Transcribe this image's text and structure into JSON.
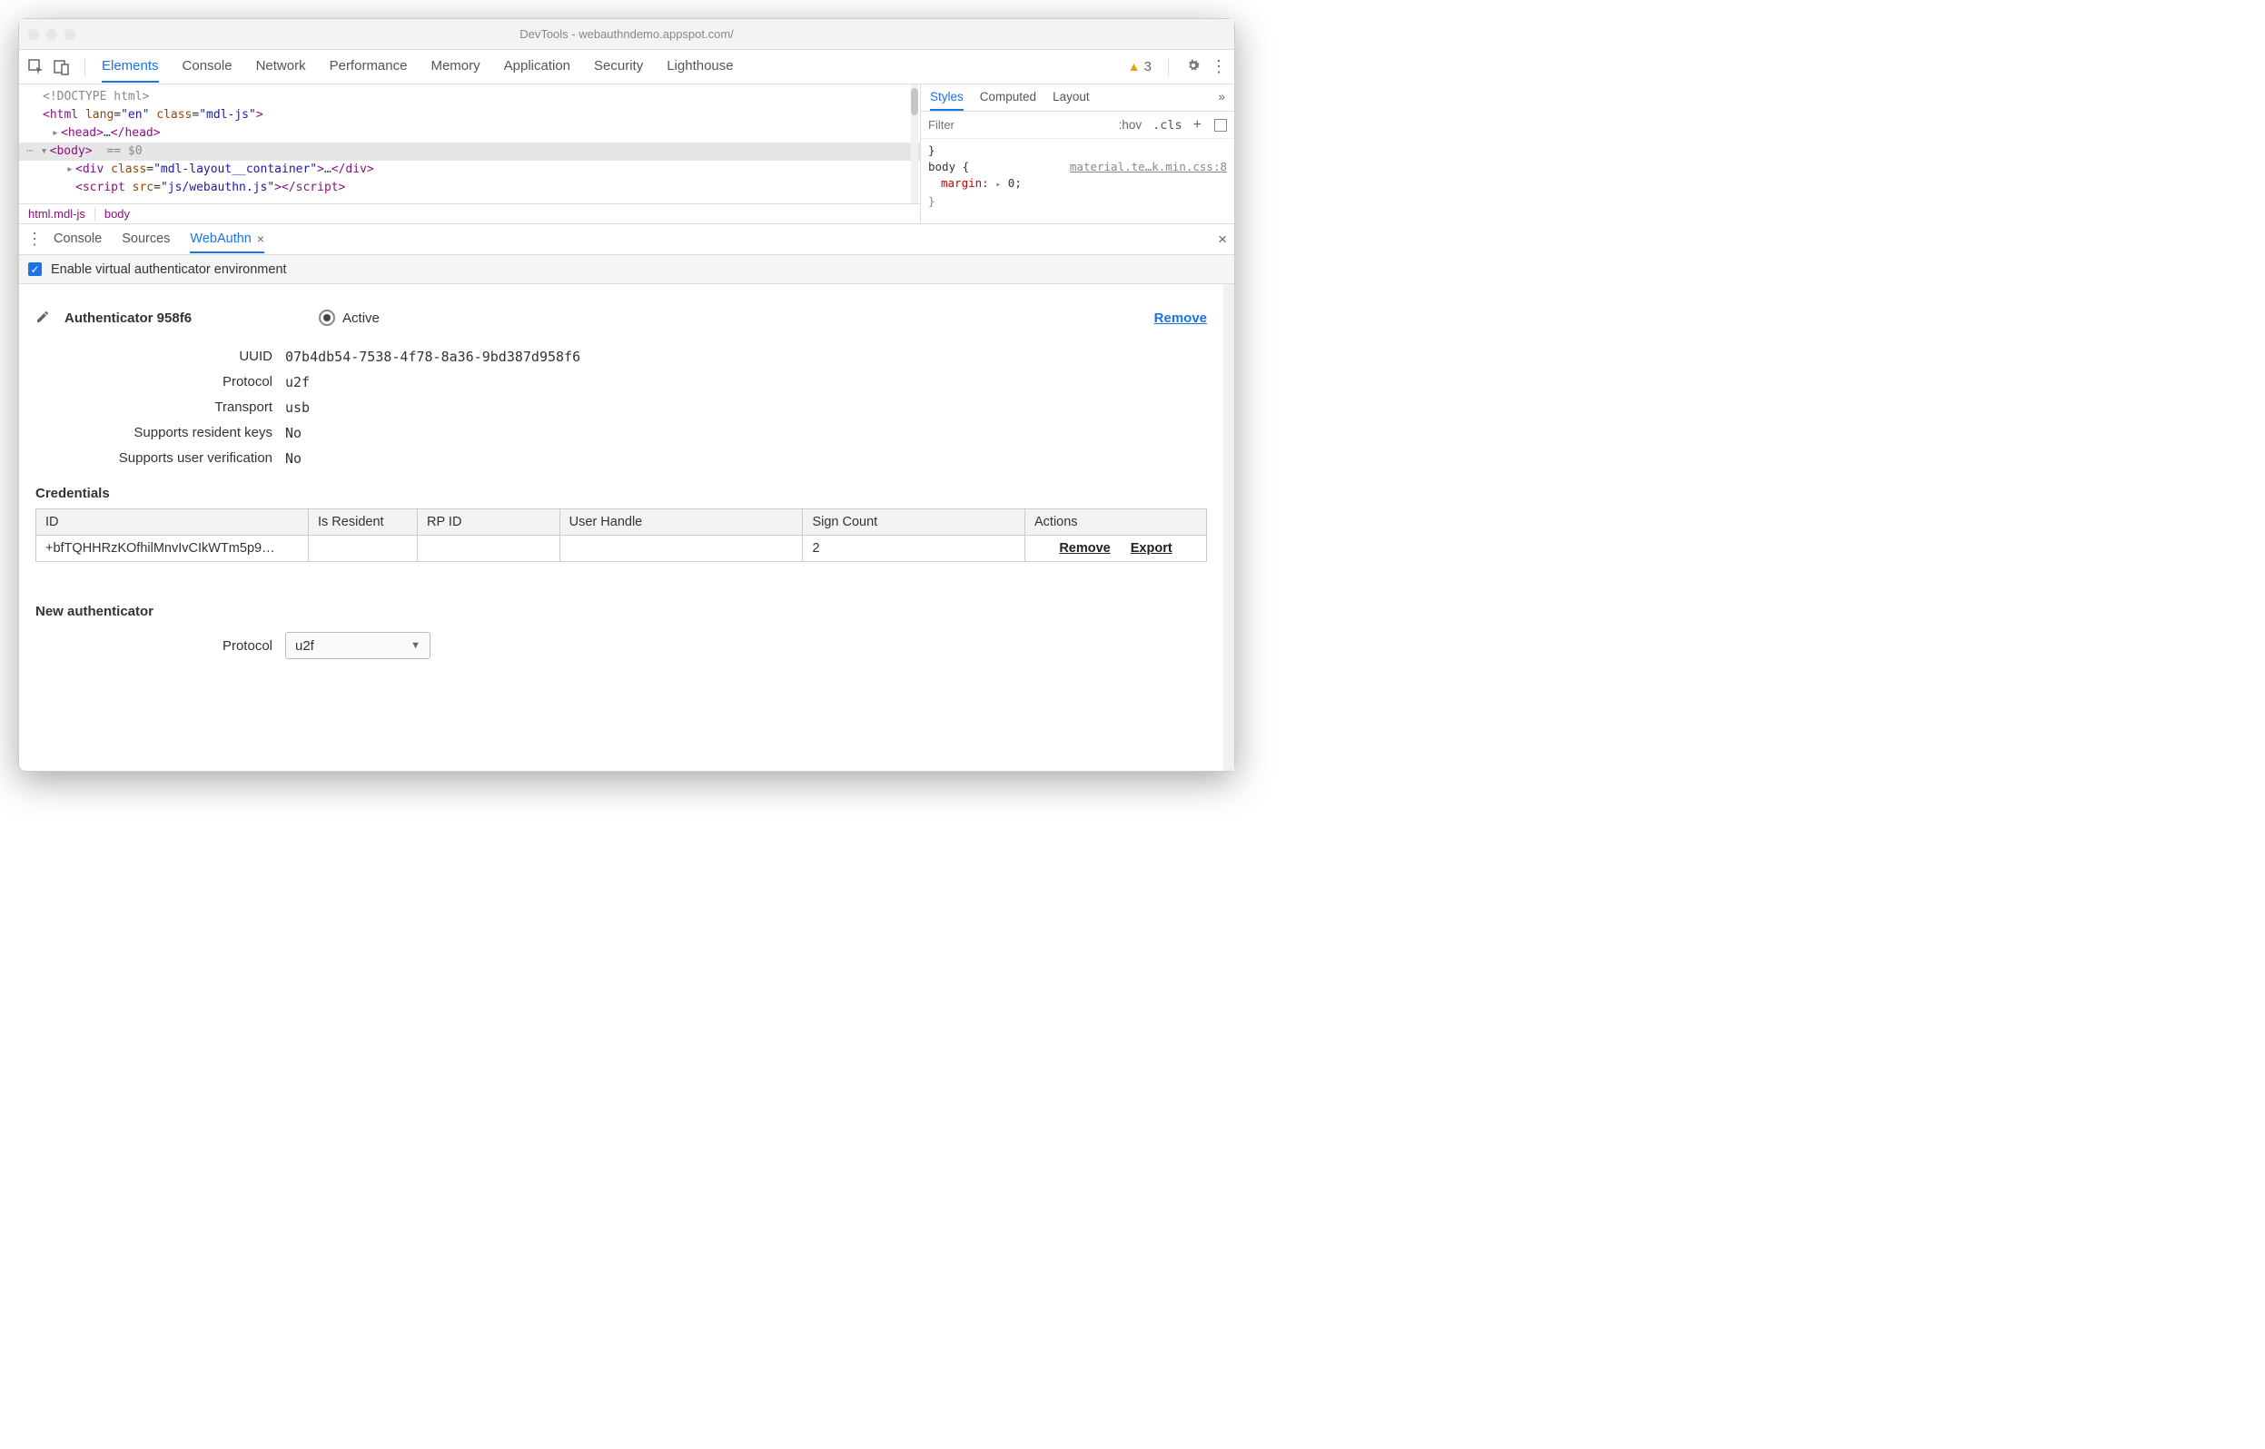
{
  "title": "DevTools - webauthndemo.appspot.com/",
  "toolbar": {
    "tabs": [
      "Elements",
      "Console",
      "Network",
      "Performance",
      "Memory",
      "Application",
      "Security",
      "Lighthouse"
    ],
    "active": 0,
    "warnings": "3"
  },
  "dom": {
    "doctype": "<!DOCTYPE html>",
    "html_open": "<html lang=\"en\" class=\"mdl-js\">",
    "head": "<head>…</head>",
    "body_sel": "<body> == $0",
    "div": "<div class=\"mdl-layout__container\">…</div>",
    "script": "<script src=\"js/webauthn.js\"></script>",
    "breadcrumb": [
      "html.mdl-js",
      "body"
    ]
  },
  "styles": {
    "tabs": [
      "Styles",
      "Computed",
      "Layout"
    ],
    "filter_ph": "Filter",
    "hov": ":hov",
    "cls": ".cls",
    "brace1": "}",
    "selector": "body {",
    "link": "material.te…k.min.css:8",
    "prop": "margin",
    "val": "0",
    "brace2": "}"
  },
  "drawer": {
    "tabs": [
      "Console",
      "Sources",
      "WebAuthn"
    ],
    "active": 2,
    "checkbox": "Enable virtual authenticator environment"
  },
  "authn": {
    "title": "Authenticator 958f6",
    "active": "Active",
    "remove": "Remove",
    "props": {
      "uuid_l": "UUID",
      "uuid": "07b4db54-7538-4f78-8a36-9bd387d958f6",
      "proto_l": "Protocol",
      "proto": "u2f",
      "trans_l": "Transport",
      "trans": "usb",
      "rk_l": "Supports resident keys",
      "rk": "No",
      "uv_l": "Supports user verification",
      "uv": "No"
    },
    "cred_h": "Credentials",
    "cred_cols": [
      "ID",
      "Is Resident",
      "RP ID",
      "User Handle",
      "Sign Count",
      "Actions"
    ],
    "cred_row": {
      "id": "+bfTQHHRzKOfhilMnvIvCIkWTm5p9…",
      "is_resident": "",
      "rp_id": "",
      "user_handle": "",
      "sign_count": "2",
      "act_remove": "Remove",
      "act_export": "Export"
    },
    "new_h": "New authenticator",
    "new_proto_l": "Protocol",
    "new_proto_v": "u2f"
  }
}
